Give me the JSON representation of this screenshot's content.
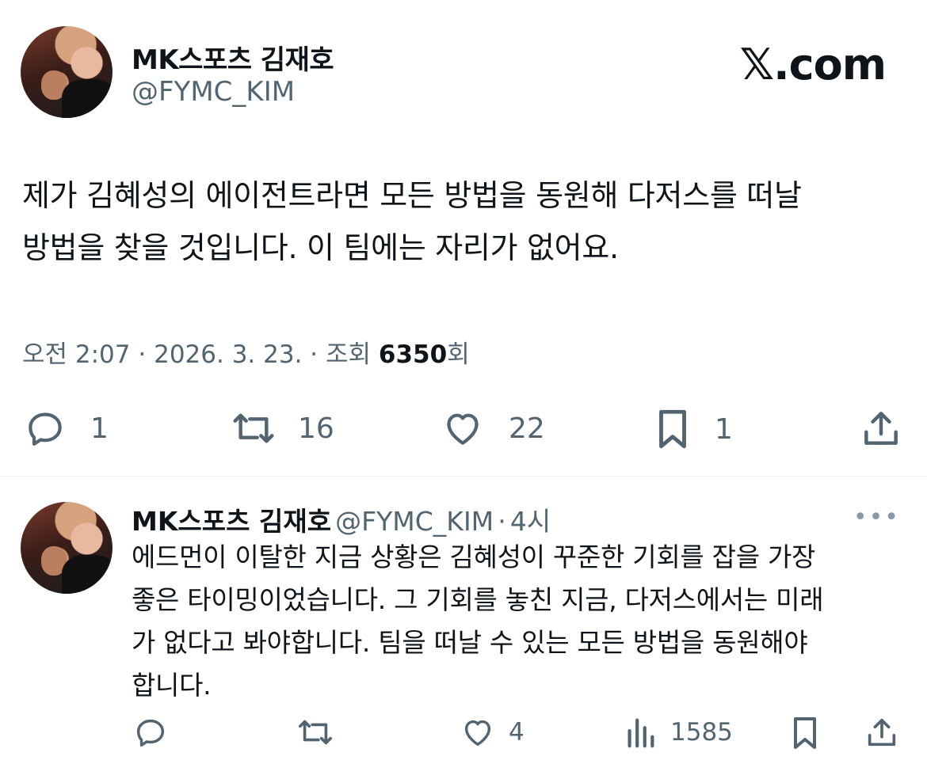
{
  "brand": {
    "logo_text": "𝕏.com"
  },
  "tweet": {
    "author_name": "MK스포츠 김재호",
    "author_handle": "@FYMC_KIM",
    "text_line1": "제가 김혜성의 에이전트라면 모든 방법을 동원해 다저스를 떠날",
    "text_line2": "방법을 찾을 것입니다. 이 팀에는 자리가 없어요.",
    "time": "오전 2:07",
    "sep": "·",
    "date": "2026. 3. 23.",
    "views_label": "조회",
    "views_count": "6350",
    "views_suffix": "회",
    "replies": "1",
    "reposts": "16",
    "likes": "22",
    "bookmarks": "1"
  },
  "reply": {
    "author_name": "MK스포츠 김재호",
    "author_handle": "@FYMC_KIM",
    "sep": "·",
    "age": "4시",
    "more": "•••",
    "lines": [
      "에드먼이 이탈한 지금 상황은 김혜성이 꾸준한 기회를 잡을 가장",
      "좋은 타이밍이었습니다. 그 기회를 놓친 지금, 다저스에서는 미래",
      "가 없다고 봐야합니다. 팀을 떠날 수 있는 모든 방법을 동원해야",
      "합니다."
    ],
    "likes": "4",
    "views": "1585"
  },
  "colors": {
    "text": "#0f1419",
    "secondary": "#536471",
    "divider": "#eff3f4"
  }
}
